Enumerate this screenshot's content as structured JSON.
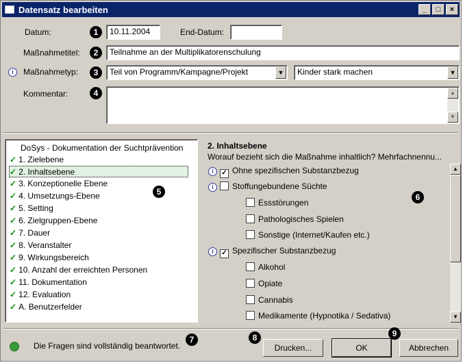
{
  "window": {
    "title": "Datensatz bearbeiten",
    "controls": [
      "_",
      "□",
      "×"
    ]
  },
  "form": {
    "datum_label": "Datum:",
    "datum_value": "10.11.2004",
    "end_datum_label": "End-Datum:",
    "end_datum_value": "",
    "massnahmetitel_label": "Maßnahmetitel:",
    "massnahmetitel_value": "Teilnahme an der Multiplikatorenschulung",
    "massnahmetyp_label": "Maßnahmetyp:",
    "massnahmetyp_value": "Teil von Programm/Kampagne/Projekt",
    "programm_value": "Kinder stark machen",
    "kommentar_label": "Kommentar:",
    "kommentar_value": ""
  },
  "badges": [
    "1",
    "2",
    "3",
    "4",
    "5",
    "6",
    "7",
    "8",
    "9"
  ],
  "info_glyph": "i",
  "nav": {
    "header": "DoSys - Dokumentation der Suchtprävention",
    "check_glyph": "✓",
    "items": [
      "1. Zielebene",
      "2. Inhaltsebene",
      "3. Konzeptionelle Ebene",
      "4. Umsetzungs-Ebene",
      "5. Setting",
      "6. Zielgruppen-Ebene",
      "7. Dauer",
      "8. Veranstalter",
      "9. Wirkungsbereich",
      "10. Anzahl der erreichten Personen",
      "11. Dokumentation",
      "12. Evaluation",
      "A. Benutzerfelder"
    ],
    "selected_index": 1
  },
  "panel": {
    "title": "2. Inhaltsebene",
    "subtitle": "Worauf bezieht sich die Maßnahme inhaltlich? Mehrfachnennu...",
    "checkboxes": [
      {
        "label": "Ohne spezifischen Substanzbezug",
        "checked": true,
        "info": true,
        "indent": 0
      },
      {
        "label": "Stoffungebundene Süchte",
        "checked": false,
        "info": true,
        "indent": 0
      },
      {
        "label": "Essstörungen",
        "checked": false,
        "info": false,
        "indent": 1
      },
      {
        "label": "Pathologisches Spielen",
        "checked": false,
        "info": false,
        "indent": 1
      },
      {
        "label": "Sonstige (Internet/Kaufen etc.)",
        "checked": false,
        "info": false,
        "indent": 1
      },
      {
        "label": "Spezifischer Substanzbezug",
        "checked": true,
        "info": true,
        "indent": 0
      },
      {
        "label": "Alkohol",
        "checked": false,
        "info": false,
        "indent": 1
      },
      {
        "label": "Opiate",
        "checked": false,
        "info": false,
        "indent": 1
      },
      {
        "label": "Cannabis",
        "checked": false,
        "info": false,
        "indent": 1
      },
      {
        "label": "Medikamente (Hypnotika / Sedativa)",
        "checked": false,
        "info": false,
        "indent": 1
      }
    ]
  },
  "status": {
    "text": "Die Fragen sind vollständig beantwortet."
  },
  "buttons": {
    "drucken": "Drucken...",
    "ok": "OK",
    "abbrechen": "Abbrechen"
  }
}
